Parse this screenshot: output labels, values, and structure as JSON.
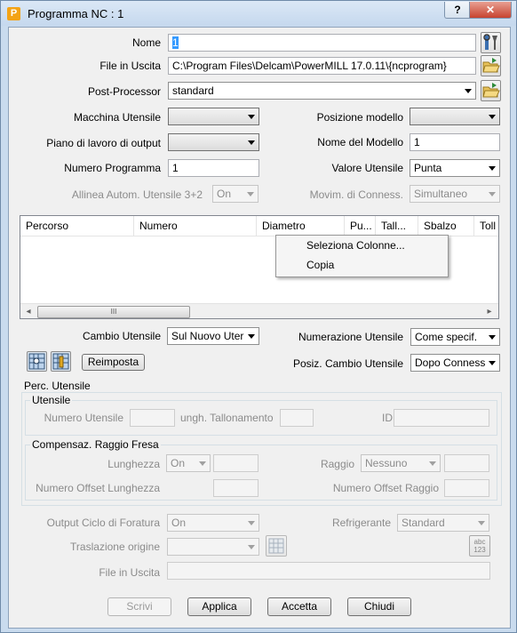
{
  "window": {
    "title": "Programma NC : 1",
    "help": "?",
    "close": "✕"
  },
  "labels": {
    "nome": "Nome",
    "file_uscita": "File in Uscita",
    "post_processor": "Post-Processor",
    "macchina": "Macchina Utensile",
    "posizione_modello": "Posizione modello",
    "piano": "Piano di lavoro di output",
    "nome_modello": "Nome del Modello",
    "numero_programma": "Numero Programma",
    "valore_utensile": "Valore Utensile",
    "allinea": "Allinea Autom. Utensile 3+2",
    "movim": "Movim. di Conness.",
    "cambio_utensile": "Cambio Utensile",
    "numerazione_utensile": "Numerazione Utensile",
    "posiz_cambio": "Posiz. Cambio Utensile",
    "perc_utensile": "Perc. Utensile",
    "utensile_group": "Utensile",
    "numero_utensile": "Numero Utensile",
    "lungh_tallonamento": "ungh. Tallonamento",
    "id": "ID",
    "compensaz": "Compensaz. Raggio Fresa",
    "lunghezza": "Lunghezza",
    "raggio": "Raggio",
    "num_offset_lunghezza": "Numero Offset Lunghezza",
    "num_offset_raggio": "Numero Offset Raggio",
    "output_ciclo": "Output Ciclo di Foratura",
    "refrigerante": "Refrigerante",
    "traslazione": "Traslazione origine",
    "file_uscita2": "File in Uscita"
  },
  "values": {
    "nome": "1",
    "file_uscita": "C:\\Program Files\\Delcam\\PowerMILL 17.0.11\\{ncprogram}",
    "post_processor": "standard",
    "macchina": "",
    "posizione_modello": "",
    "piano": "",
    "nome_modello": "1",
    "numero_programma": "1",
    "valore_utensile": "Punta",
    "allinea": "On",
    "movim": "Simultaneo",
    "cambio_utensile": "Sul Nuovo Uter",
    "numerazione_utensile": "Come specif.",
    "posiz_cambio": "Dopo Conness",
    "lunghezza": "On",
    "raggio": "Nessuno",
    "output_ciclo": "On",
    "refrigerante": "Standard",
    "traslazione": ""
  },
  "table": {
    "columns": [
      "Percorso",
      "Numero",
      "Diametro",
      "Pu...",
      "Tall...",
      "Sbalzo",
      "Toll"
    ],
    "scroll_grip": "III",
    "left_arrow": "◂",
    "right_arrow": "▸"
  },
  "context_menu": {
    "items": [
      "Seleziona Colonne...",
      "Copia"
    ]
  },
  "buttons": {
    "reimposta": "Reimposta",
    "scrivi": "Scrivi",
    "applica": "Applica",
    "accetta": "Accetta",
    "chiudi": "Chiudi"
  },
  "icons": {
    "abc": "abc",
    "num": "123",
    "app": "P"
  }
}
